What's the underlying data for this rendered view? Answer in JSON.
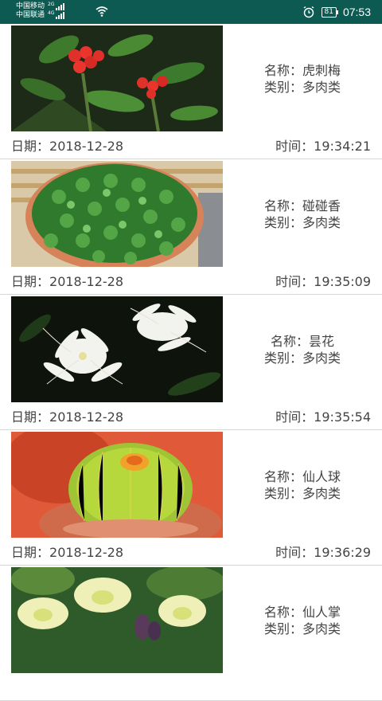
{
  "status_bar": {
    "carrier1": "中国移动",
    "carrier1_net": "2G",
    "carrier2": "中国联通",
    "carrier2_net": "4G",
    "battery": "81",
    "time": "07:53"
  },
  "colors": {
    "status_bar": "#0c5a52",
    "divider": "#d8d8d8",
    "text": "#444444"
  },
  "labels": {
    "name_prefix": "名称：",
    "category_prefix": "类别：",
    "date_prefix": "日期：",
    "time_prefix": "时间："
  },
  "items": [
    {
      "name": "虎刺梅",
      "category": "多肉类",
      "date": "2018-12-28",
      "time": "19:34:21",
      "image": "red-flower-photo"
    },
    {
      "name": "碰碰香",
      "category": "多肉类",
      "date": "2018-12-28",
      "time": "19:35:09",
      "image": "green-pot-plant-photo"
    },
    {
      "name": "昙花",
      "category": "多肉类",
      "date": "2018-12-28",
      "time": "19:35:54",
      "image": "white-flower-photo"
    },
    {
      "name": "仙人球",
      "category": "多肉类",
      "date": "2018-12-28",
      "time": "19:36:29",
      "image": "cactus-ball-photo"
    },
    {
      "name": "仙人掌",
      "category": "多肉类",
      "date": "",
      "time": "",
      "image": "cactus-flower-photo"
    }
  ]
}
